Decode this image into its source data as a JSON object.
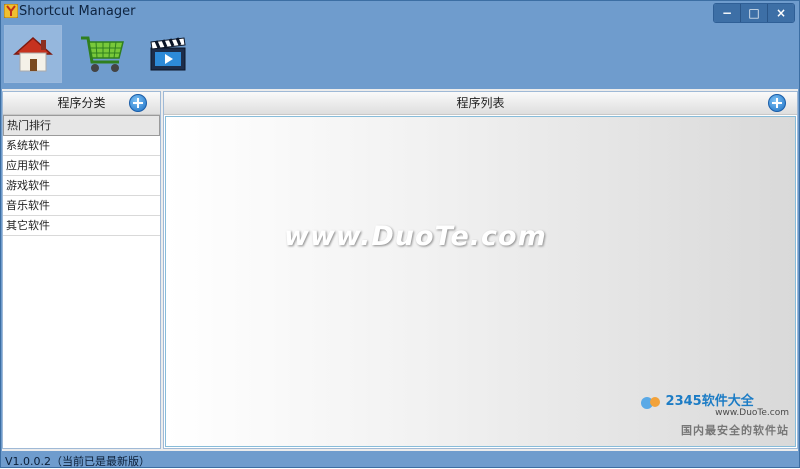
{
  "window": {
    "title": "Shortcut Manager"
  },
  "controls": {
    "minimize": "−",
    "maximize": "□",
    "close": "×"
  },
  "toolbar": {
    "items": [
      "home-icon",
      "shopping-cart-icon",
      "film-clapper-icon"
    ],
    "active_index": 0
  },
  "left_panel": {
    "header": "程序分类",
    "categories": [
      "热门排行",
      "系统软件",
      "应用软件",
      "游戏软件",
      "音乐软件",
      "其它软件"
    ],
    "selected_index": 0
  },
  "right_panel": {
    "header": "程序列表"
  },
  "watermarks": {
    "main": "www.DuoTe.com",
    "brand": "2345软件大全",
    "url": "www.DuoTe.com",
    "slogan": "国内最安全的软件站"
  },
  "status": {
    "text": "V1.0.0.2（当前已是最新版）"
  },
  "colors": {
    "window_bg": "#6f9ccd",
    "accent": "#1b6fc4",
    "list_border": "#88bcd9"
  }
}
